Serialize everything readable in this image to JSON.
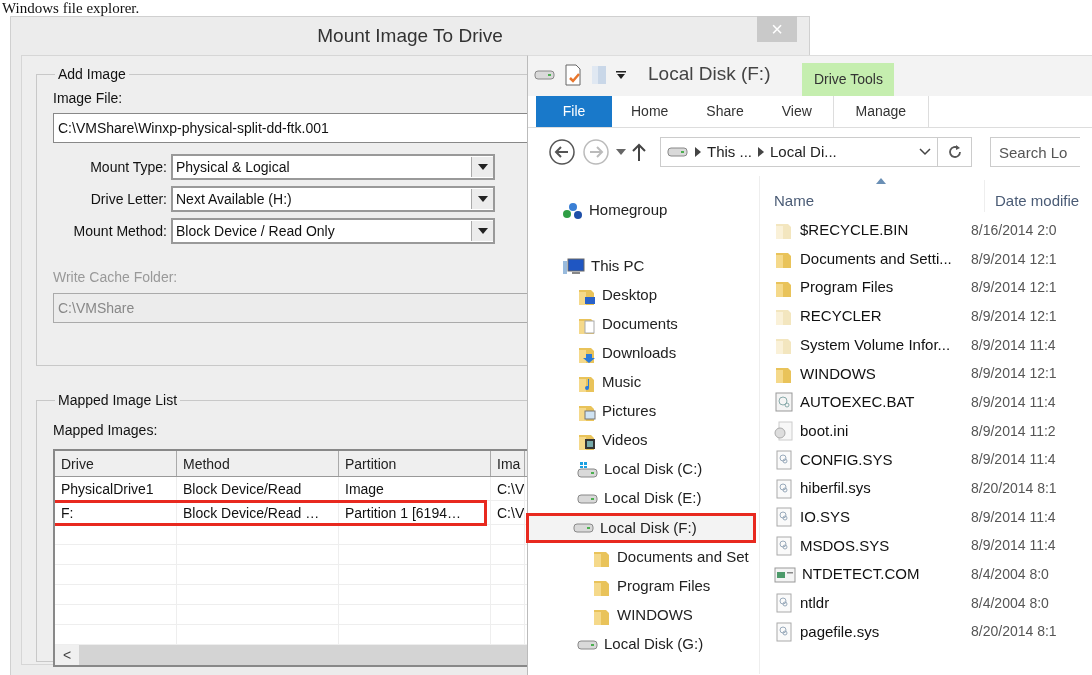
{
  "caption": "Windows file explorer.",
  "dialog": {
    "title": "Mount Image To Drive",
    "close_button": "×",
    "add_image": {
      "legend": "Add Image",
      "image_file_label": "Image File:",
      "image_file": "C:\\VMShare\\Winxp-physical-split-dd-ftk.001",
      "combos": [
        {
          "label": "Mount Type:",
          "value": "Physical & Logical"
        },
        {
          "label": "Drive Letter:",
          "value": "Next Available (H:)"
        },
        {
          "label": "Mount Method:",
          "value": "Block Device / Read Only"
        }
      ],
      "write_cache": {
        "label": "Write Cache Folder:",
        "value": "C:\\VMShare",
        "disabled": true
      }
    },
    "mapped": {
      "legend": "Mapped Image List",
      "label": "Mapped Images:",
      "columns": [
        "Drive",
        "Method",
        "Partition",
        "Ima"
      ],
      "rows": [
        {
          "cells": [
            "PhysicalDrive1",
            "Block Device/Read",
            "Image",
            "C:\\V"
          ],
          "highlighted": false
        },
        {
          "cells": [
            "F:",
            "Block Device/Read …",
            "Partition 1 [6194…",
            "C:\\V"
          ],
          "highlighted": true
        }
      ],
      "scroll_left": "<"
    }
  },
  "explorer": {
    "title": "Local Disk (F:)",
    "context_group": "Drive Tools",
    "tabs": [
      {
        "label": "File",
        "kind": "file"
      },
      {
        "label": "Home",
        "kind": "tab"
      },
      {
        "label": "Share",
        "kind": "tab"
      },
      {
        "label": "View",
        "kind": "tab"
      },
      {
        "label": "Manage",
        "kind": "context"
      }
    ],
    "breadcrumbs": [
      "This ...",
      "Local Di..."
    ],
    "search": {
      "placeholder": "Search Lo"
    },
    "nav": [
      {
        "label": "Homegroup",
        "kind": "homegroup",
        "highlighted": false
      },
      {
        "label": "This PC",
        "kind": "pc",
        "highlighted": false,
        "children": [
          {
            "label": "Desktop",
            "kind": "desktop",
            "highlighted": false
          },
          {
            "label": "Documents",
            "kind": "documents",
            "highlighted": false
          },
          {
            "label": "Downloads",
            "kind": "downloads",
            "highlighted": false
          },
          {
            "label": "Music",
            "kind": "music",
            "highlighted": false
          },
          {
            "label": "Pictures",
            "kind": "pictures",
            "highlighted": false
          },
          {
            "label": "Videos",
            "kind": "videos",
            "highlighted": false
          },
          {
            "label": "Local Disk (C:)",
            "kind": "windrive",
            "highlighted": false
          },
          {
            "label": "Local Disk (E:)",
            "kind": "drive",
            "highlighted": false
          },
          {
            "label": "Local Disk (F:)",
            "kind": "drive",
            "highlighted": true,
            "children": [
              {
                "label": "Documents and Set",
                "kind": "folder",
                "highlighted": false
              },
              {
                "label": "Program Files",
                "kind": "folder",
                "highlighted": false
              },
              {
                "label": "WINDOWS",
                "kind": "folder",
                "highlighted": false
              }
            ]
          },
          {
            "label": "Local Disk (G:)",
            "kind": "drive",
            "highlighted": false
          }
        ]
      }
    ],
    "columns": [
      "Name",
      "Date modifie"
    ],
    "files": [
      {
        "name": "$RECYCLE.BIN",
        "date": "8/16/2014 2:0",
        "kind": "folder",
        "hidden": true
      },
      {
        "name": "Documents and Setti...",
        "date": "8/9/2014 12:1",
        "kind": "folder",
        "hidden": false
      },
      {
        "name": "Program Files",
        "date": "8/9/2014 12:1",
        "kind": "folder",
        "hidden": false
      },
      {
        "name": "RECYCLER",
        "date": "8/9/2014 12:1",
        "kind": "folder",
        "hidden": true
      },
      {
        "name": "System Volume Infor...",
        "date": "8/9/2014 11:4",
        "kind": "folder",
        "hidden": true
      },
      {
        "name": "WINDOWS",
        "date": "8/9/2014 12:1",
        "kind": "folder",
        "hidden": false
      },
      {
        "name": "AUTOEXEC.BAT",
        "date": "8/9/2014 11:4",
        "kind": "batch",
        "hidden": false
      },
      {
        "name": "boot.ini",
        "date": "8/9/2014 11:2",
        "kind": "settings",
        "hidden": false
      },
      {
        "name": "CONFIG.SYS",
        "date": "8/9/2014 11:4",
        "kind": "system",
        "hidden": false
      },
      {
        "name": "hiberfil.sys",
        "date": "8/20/2014 8:1",
        "kind": "system",
        "hidden": false
      },
      {
        "name": "IO.SYS",
        "date": "8/9/2014 11:4",
        "kind": "system",
        "hidden": false
      },
      {
        "name": "MSDOS.SYS",
        "date": "8/9/2014 11:4",
        "kind": "system",
        "hidden": false
      },
      {
        "name": "NTDETECT.COM",
        "date": "8/4/2004 8:0",
        "kind": "program",
        "hidden": false
      },
      {
        "name": "ntldr",
        "date": "8/4/2004 8:0",
        "kind": "system",
        "hidden": false
      },
      {
        "name": "pagefile.sys",
        "date": "8/20/2014 8:1",
        "kind": "system",
        "hidden": false
      }
    ]
  }
}
